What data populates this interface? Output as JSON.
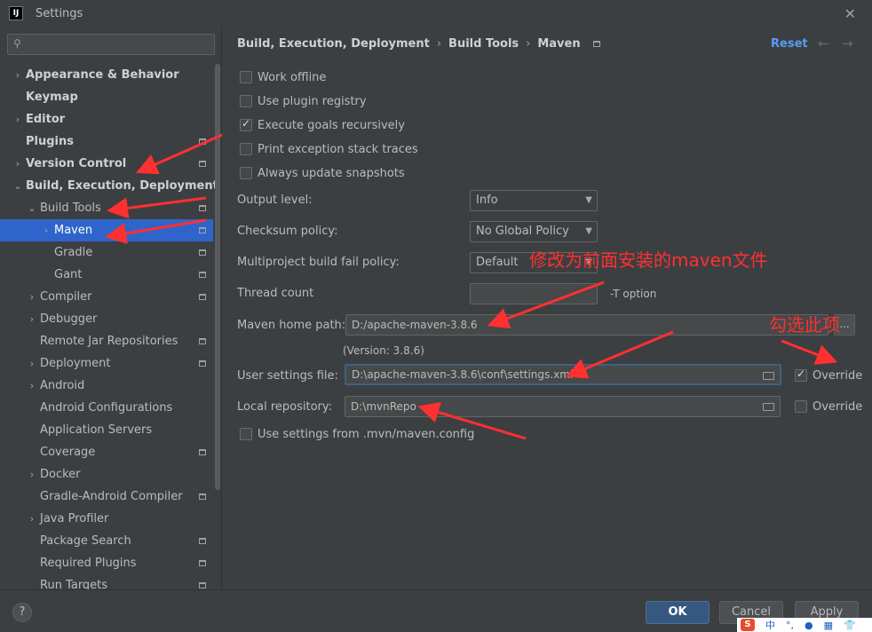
{
  "window": {
    "title": "Settings",
    "logo_text": "IJ",
    "close_glyph": "✕"
  },
  "sidebar": {
    "search_placeholder": "",
    "items": [
      {
        "label": "Appearance & Behavior",
        "bold": true,
        "chevron": "›",
        "indent": 0
      },
      {
        "label": "Keymap",
        "bold": true,
        "chevron": "",
        "indent": 0
      },
      {
        "label": "Editor",
        "bold": true,
        "chevron": "›",
        "indent": 0
      },
      {
        "label": "Plugins",
        "bold": true,
        "chevron": "",
        "indent": 0,
        "pin": true
      },
      {
        "label": "Version Control",
        "bold": true,
        "chevron": "›",
        "indent": 0,
        "pin": true
      },
      {
        "label": "Build, Execution, Deployment",
        "bold": true,
        "chevron": "⌄",
        "indent": 0
      },
      {
        "label": "Build Tools",
        "bold": false,
        "chevron": "⌄",
        "indent": 1,
        "pin": true
      },
      {
        "label": "Maven",
        "bold": false,
        "chevron": "›",
        "indent": 2,
        "pin": true,
        "selected": true
      },
      {
        "label": "Gradle",
        "bold": false,
        "chevron": "",
        "indent": 2,
        "pin": true
      },
      {
        "label": "Gant",
        "bold": false,
        "chevron": "",
        "indent": 2,
        "pin": true
      },
      {
        "label": "Compiler",
        "bold": false,
        "chevron": "›",
        "indent": 1,
        "pin": true
      },
      {
        "label": "Debugger",
        "bold": false,
        "chevron": "›",
        "indent": 1
      },
      {
        "label": "Remote Jar Repositories",
        "bold": false,
        "chevron": "",
        "indent": 1,
        "pin": true
      },
      {
        "label": "Deployment",
        "bold": false,
        "chevron": "›",
        "indent": 1,
        "pin": true
      },
      {
        "label": "Android",
        "bold": false,
        "chevron": "›",
        "indent": 1
      },
      {
        "label": "Android Configurations",
        "bold": false,
        "chevron": "",
        "indent": 1
      },
      {
        "label": "Application Servers",
        "bold": false,
        "chevron": "",
        "indent": 1
      },
      {
        "label": "Coverage",
        "bold": false,
        "chevron": "",
        "indent": 1,
        "pin": true
      },
      {
        "label": "Docker",
        "bold": false,
        "chevron": "›",
        "indent": 1
      },
      {
        "label": "Gradle-Android Compiler",
        "bold": false,
        "chevron": "",
        "indent": 1,
        "pin": true
      },
      {
        "label": "Java Profiler",
        "bold": false,
        "chevron": "›",
        "indent": 1
      },
      {
        "label": "Package Search",
        "bold": false,
        "chevron": "",
        "indent": 1,
        "pin": true
      },
      {
        "label": "Required Plugins",
        "bold": false,
        "chevron": "",
        "indent": 1,
        "pin": true
      },
      {
        "label": "Run Targets",
        "bold": false,
        "chevron": "",
        "indent": 1,
        "pin": true
      }
    ]
  },
  "main": {
    "breadcrumb": [
      "Build, Execution, Deployment",
      "Build Tools",
      "Maven"
    ],
    "breadcrumb_sep": "›",
    "reset_label": "Reset",
    "back_arrow": "←",
    "forward_arrow": "→",
    "checkboxes": [
      {
        "label": "Work offline",
        "checked": false
      },
      {
        "label": "Use plugin registry",
        "checked": false
      },
      {
        "label": "Execute goals recursively",
        "checked": true
      },
      {
        "label": "Print exception stack traces",
        "checked": false
      },
      {
        "label": "Always update snapshots",
        "checked": false
      }
    ],
    "output_level": {
      "label": "Output level:",
      "value": "Info"
    },
    "checksum_policy": {
      "label": "Checksum policy:",
      "value": "No Global Policy"
    },
    "multiproject_policy": {
      "label": "Multiproject build fail policy:",
      "value": "Default"
    },
    "thread_count": {
      "label": "Thread count",
      "value": "",
      "hint": "-T option"
    },
    "maven_home": {
      "label": "Maven home path:",
      "value": "D:/apache-maven-3.8.6",
      "browse": "..."
    },
    "version_text": "(Version: 3.8.6)",
    "user_settings": {
      "label": "User settings file:",
      "value": "D:\\apache-maven-3.8.6\\conf\\settings.xml",
      "override_label": "Override",
      "override_checked": true
    },
    "local_repo": {
      "label": "Local repository:",
      "value": "D:\\mvnRepo",
      "override_label": "Override",
      "override_checked": false
    },
    "use_mvn_config": {
      "label": "Use settings from .mvn/maven.config",
      "checked": false
    }
  },
  "annotations": {
    "modify_note": "修改为前面安装的maven文件",
    "check_note": "勾选此项"
  },
  "footer": {
    "help": "?",
    "ok": "OK",
    "cancel": "Cancel",
    "apply": "Apply"
  },
  "ime": {
    "logo": "S",
    "items": [
      "中",
      "°,",
      "●",
      "▦",
      "👕"
    ]
  },
  "colors": {
    "accent": "#2f65ca",
    "link": "#589df6",
    "annotation": "#ff3030",
    "background": "#3c3f41"
  }
}
